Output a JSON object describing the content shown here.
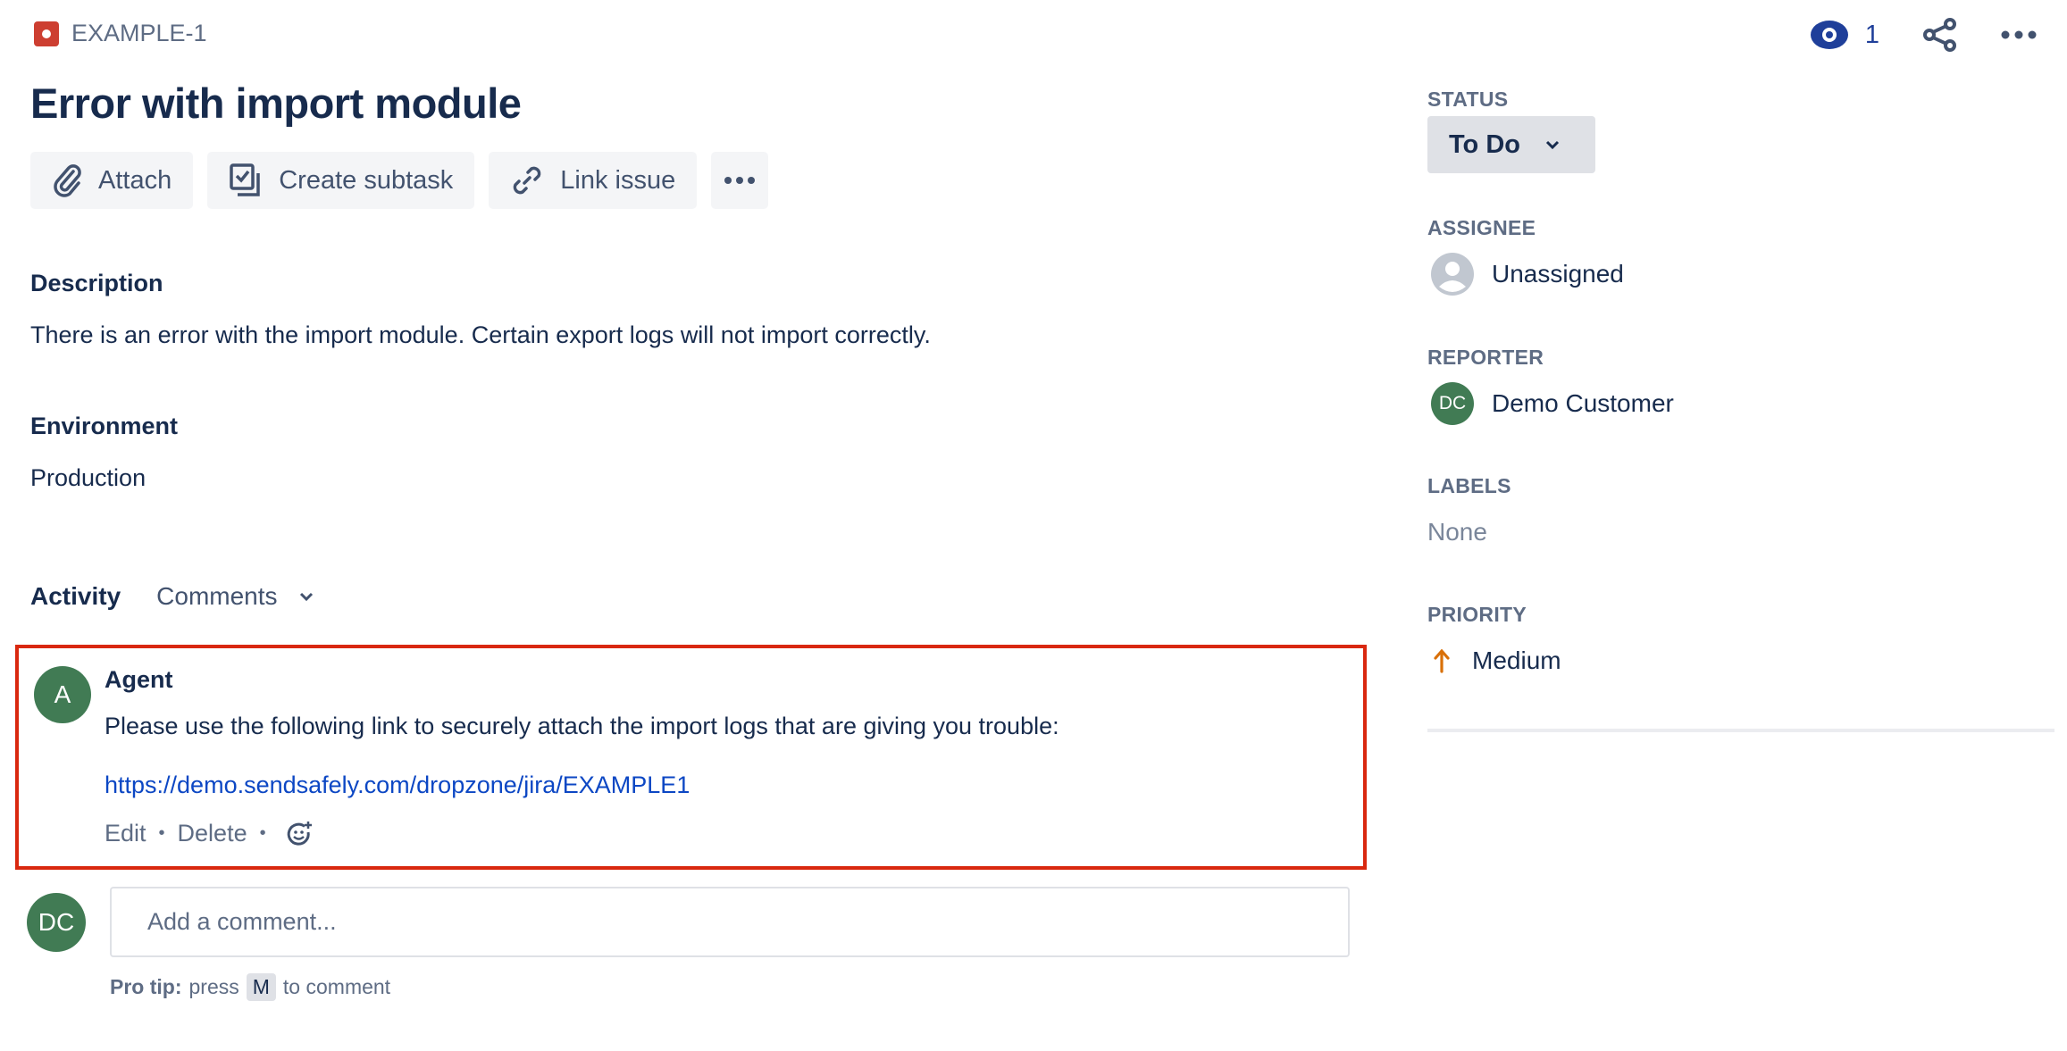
{
  "issue": {
    "key": "EXAMPLE-1",
    "type_icon": "bug-icon",
    "title": "Error with import module",
    "watch_count": "1"
  },
  "toolbar": {
    "attach_label": "Attach",
    "create_subtask_label": "Create subtask",
    "link_issue_label": "Link issue"
  },
  "description": {
    "heading": "Description",
    "text": "There is an error with the import module. Certain export logs will not import correctly."
  },
  "environment": {
    "heading": "Environment",
    "text": "Production"
  },
  "activity": {
    "heading": "Activity",
    "filter_label": "Comments",
    "comments": [
      {
        "avatar_initials": "A",
        "author": "Agent",
        "text": "Please use the following link to securely attach the import logs that are giving you trouble:",
        "link": "https://demo.sendsafely.com/dropzone/jira/EXAMPLE1",
        "actions": [
          "Edit",
          "Delete"
        ]
      }
    ],
    "new_comment": {
      "avatar_initials": "DC",
      "placeholder": "Add a comment...",
      "protip_bold": "Pro tip:",
      "protip_press": "press",
      "protip_key": "M",
      "protip_after": "to comment"
    }
  },
  "sidebar": {
    "status": {
      "label": "STATUS",
      "value": "To Do"
    },
    "assignee": {
      "label": "ASSIGNEE",
      "value": "Unassigned"
    },
    "reporter": {
      "label": "REPORTER",
      "value": "Demo Customer",
      "initials": "DC"
    },
    "labels": {
      "label": "LABELS",
      "value": "None"
    },
    "priority": {
      "label": "PRIORITY",
      "value": "Medium"
    }
  },
  "colors": {
    "highlight_border": "#d9280f",
    "link": "#0c47c4",
    "avatar_green": "#417b54",
    "priority_medium": "#d97008",
    "watch_blue": "#1f3f9a",
    "bug_red": "#cd3f31"
  }
}
